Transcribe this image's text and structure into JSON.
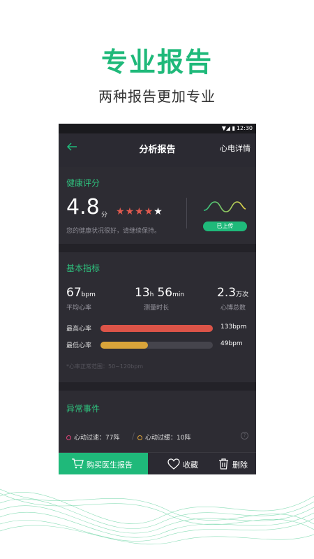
{
  "promo": {
    "title": "专业报告",
    "subtitle": "两种报告更加专业"
  },
  "status_bar": {
    "time": "12:30",
    "icons": "▼◢ ▮"
  },
  "app_bar": {
    "title": "分析报告",
    "action": "心电详情",
    "back_icon": "arrow-left-icon"
  },
  "health_score": {
    "section_title": "健康评分",
    "score": "4.8",
    "unit": "分",
    "stars_filled": 4,
    "stars_total": 5,
    "description": "您的健康状况很好，请继续保持。",
    "upload_status": "已上传"
  },
  "basic_metrics": {
    "section_title": "基本指标",
    "items": [
      {
        "value": "67",
        "unit": "bpm",
        "label": "平均心率"
      },
      {
        "value_h": "13",
        "unit_h": "h",
        "value_m": "56",
        "unit_m": "min",
        "label": "测量时长"
      },
      {
        "value": "2.3",
        "unit": "万次",
        "label": "心博总数"
      }
    ],
    "max_heart_rate": {
      "label": "最高心率",
      "value": "133bpm",
      "fill": 1.0,
      "color": "#dc5448"
    },
    "min_heart_rate": {
      "label": "最低心率",
      "value": "49bpm",
      "fill": 0.42,
      "color": "#d9a43a"
    },
    "normal_range": "*心率正常范围：50~120bpm"
  },
  "abnormal_events": {
    "section_title": "异常事件",
    "events": [
      {
        "label": "心动过速：77阵",
        "color": "#e0457a"
      },
      {
        "label": "心动过缓：10阵",
        "color": "#e0a43a"
      }
    ],
    "help_icon": "question-icon"
  },
  "bottom_bar": {
    "buy_label": "购买医生报告",
    "favorite_label": "收藏",
    "delete_label": "删除"
  },
  "colors": {
    "accent": "#1fb97a",
    "background": "#2b2a32"
  }
}
